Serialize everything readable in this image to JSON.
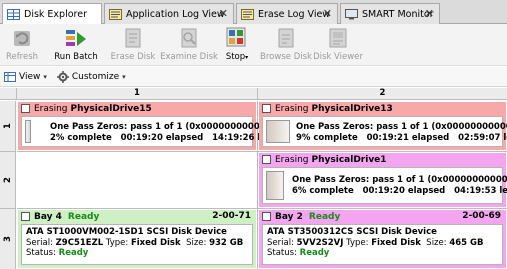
{
  "tabs": [
    {
      "label": "Disk Explorer",
      "active": true,
      "closable": false,
      "icon": "grid-icon"
    },
    {
      "label": "Application Log View",
      "active": false,
      "closable": true,
      "icon": "log-icon"
    },
    {
      "label": "Erase Log View",
      "active": false,
      "closable": true,
      "icon": "log-icon"
    },
    {
      "label": "SMART Monitor",
      "active": false,
      "closable": true,
      "icon": "monitor-icon"
    }
  ],
  "close_glyph": "✕",
  "toolbar": {
    "refresh": "Refresh",
    "run_batch": "Run Batch",
    "erase_disk": "Erase Disk",
    "examine_disk": "Examine Disk",
    "stop": "Stop",
    "browse_disk": "Browse Disk",
    "disk_viewer": "Disk Viewer"
  },
  "viewbar": {
    "view": "View",
    "customize": "Customize"
  },
  "grid": {
    "columns": [
      "1",
      "2"
    ],
    "rows": [
      "1",
      "2",
      "3"
    ],
    "cells": {
      "r1c1": {
        "status": "Erasing",
        "drive": "PhysicalDrive15",
        "line1": "One Pass Zeros: pass 1 of 1 (0x000000000000)",
        "line2": "2% complete   00:19:20 elapsed   14:19:26 left",
        "progress_percent": 2
      },
      "r1c2": {
        "status": "Erasing",
        "drive": "PhysicalDrive13",
        "line1": "One Pass Zeros: pass 1 of 1 (0x000000000000)",
        "line2": "9% complete   00:19:21 elapsed   02:59:07 left",
        "progress_percent": 9
      },
      "r2c2": {
        "status": "Erasing",
        "drive": "PhysicalDrive1",
        "line1": "One Pass Zeros: pass 1 of 1 (0x000000000000)",
        "line2": "6% complete   00:19:20 elapsed   04:19:53 left",
        "progress_percent": 6
      },
      "r3c1": {
        "bay": "Bay 4",
        "state": "Ready",
        "port": "2-00-71",
        "device": "ATA ST1000VM002-1SD1 SCSI Disk Device",
        "serial_label": "Serial:",
        "serial": "Z9C51EZL",
        "type_label": "Type:",
        "type": "Fixed Disk",
        "size_label": "Size:",
        "size": "932 GB",
        "status_label": "Status:",
        "status": "Ready"
      },
      "r3c2": {
        "bay": "Bay 2",
        "state": "Ready",
        "port": "2-00-69",
        "device": "ATA ST3500312CS SCSI Disk Device",
        "serial_label": "Serial:",
        "serial": "5VV2S2VJ",
        "type_label": "Type:",
        "type": "Fixed Disk",
        "size_label": "Size:",
        "size": "465 GB",
        "status_label": "Status:",
        "status": "Ready"
      }
    }
  },
  "colors": {
    "erasing_red": "#f7a8a8",
    "erasing_pink": "#f3a6ef",
    "ready_green": "#cfefc4",
    "ready_text": "#1b8a1b"
  }
}
